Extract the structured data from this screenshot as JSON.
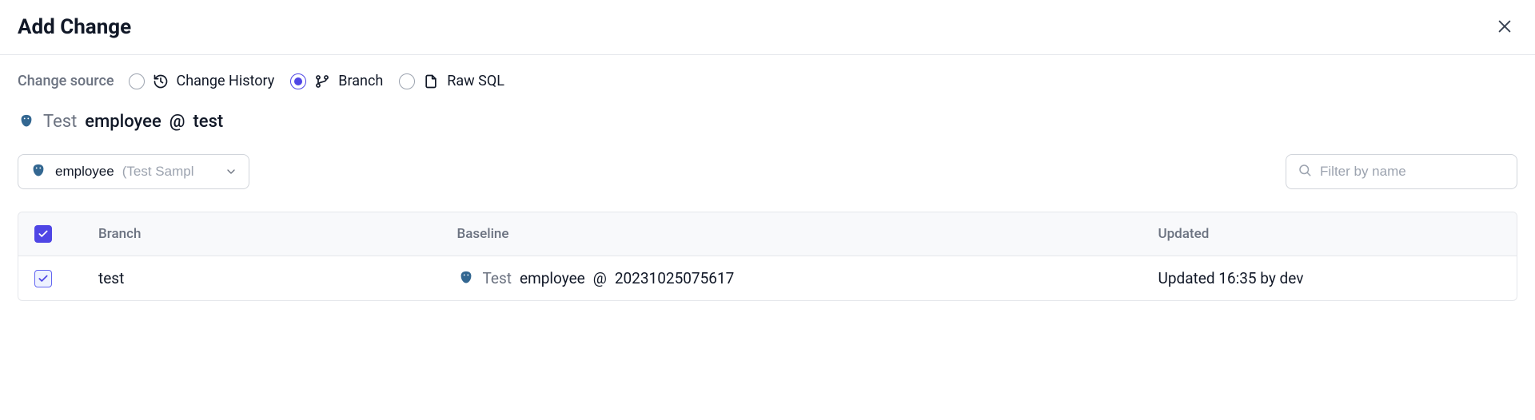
{
  "dialog": {
    "title": "Add Change"
  },
  "source": {
    "label": "Change source",
    "options": {
      "history": "Change History",
      "branch": "Branch",
      "rawsql": "Raw SQL"
    }
  },
  "context": {
    "project": "Test",
    "database": "employee",
    "at": "@",
    "branch": "test"
  },
  "dbselect": {
    "name": "employee",
    "sub": "(Test Sampl"
  },
  "search": {
    "placeholder": "Filter by name"
  },
  "table": {
    "headers": {
      "branch": "Branch",
      "baseline": "Baseline",
      "updated": "Updated"
    },
    "rows": [
      {
        "branch": "test",
        "baseline_project": "Test",
        "baseline_db": "employee",
        "baseline_at": "@",
        "baseline_version": "20231025075617",
        "updated": "Updated 16:35 by dev"
      }
    ]
  }
}
